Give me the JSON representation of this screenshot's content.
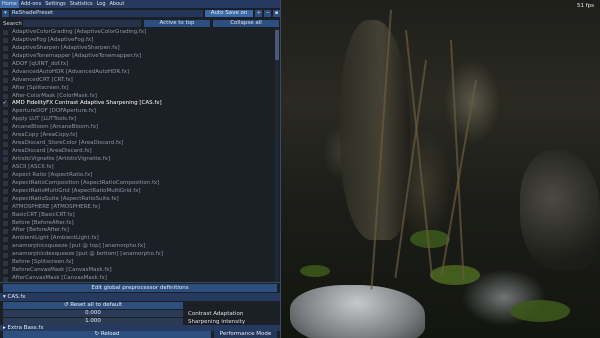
{
  "tabs": [
    "Home",
    "Add-ons",
    "Settings",
    "Statistics",
    "Log",
    "About"
  ],
  "preset": {
    "name": "ReShadePreset",
    "autosave_label": "Auto Save on"
  },
  "search": {
    "label": "Search",
    "placeholder": "",
    "active_to_top_label": "Active to top",
    "collapse_all_label": "Collapse all"
  },
  "effects": [
    {
      "label": "AdaptiveColorGrading [AdaptiveColorGrading.fx]",
      "enabled": false
    },
    {
      "label": "AdaptiveFog [AdaptiveFog.fx]",
      "enabled": false
    },
    {
      "label": "AdaptiveSharpen [AdaptiveSharpen.fx]",
      "enabled": false
    },
    {
      "label": "AdaptiveTonemapper [AdaptiveTonemapper.fx]",
      "enabled": false
    },
    {
      "label": "ADOF [qUINT_dof.fx]",
      "enabled": false
    },
    {
      "label": "AdvancedAutoHDR [AdvancedAutoHDR.fx]",
      "enabled": false
    },
    {
      "label": "AdvancedCRT [CRT.fx]",
      "enabled": false
    },
    {
      "label": "After [Splitscreen.fx]",
      "enabled": false
    },
    {
      "label": "After-ColorMask [ColorMask.fx]",
      "enabled": false
    },
    {
      "label": "AMD FidelityFX Contrast Adaptive Sharpening [CAS.fx]",
      "enabled": true
    },
    {
      "label": "ApertureDOF [DOFAperture.fx]",
      "enabled": false
    },
    {
      "label": "Apply LUT [LUTTools.fx]",
      "enabled": false
    },
    {
      "label": "ArcaneBloom [ArcaneBloom.fx]",
      "enabled": false
    },
    {
      "label": "AreaCopy [AreaCopy.fx]",
      "enabled": false
    },
    {
      "label": "AreaDiscard_StoreColor [AreaDiscard.fx]",
      "enabled": false
    },
    {
      "label": "AreaDiscard [AreaDiscard.fx]",
      "enabled": false
    },
    {
      "label": "ArtisticVignette [ArtisticVignette.fx]",
      "enabled": false
    },
    {
      "label": "ASCII [ASCII.fx]",
      "enabled": false
    },
    {
      "label": "Aspect Ratio [AspectRatio.fx]",
      "enabled": false
    },
    {
      "label": "AspectRatioComposition [AspectRatioComposition.fx]",
      "enabled": false
    },
    {
      "label": "AspectRatioMultiGrid [AspectRatioMultiGrid.fx]",
      "enabled": false
    },
    {
      "label": "AspectRatioSuite [AspectRatioSuite.fx]",
      "enabled": false
    },
    {
      "label": "ATMOSPHERE [ATMOSPHERE.fx]",
      "enabled": false
    },
    {
      "label": "BasicCRT [BasicCRT.fx]",
      "enabled": false
    },
    {
      "label": "Before [BeforeAfter.fx]",
      "enabled": false
    },
    {
      "label": "After [BeforeAfter.fx]",
      "enabled": false
    },
    {
      "label": "AmbientLight [AmbientLight.fx]",
      "enabled": false
    },
    {
      "label": "anamorphicsqueeze [put @ top] [anamorpho.fx]",
      "enabled": false
    },
    {
      "label": "anamorphicdesqueeze [put @ bottom] [anamorpho.fx]",
      "enabled": false
    },
    {
      "label": "Before [Splitscreen.fx]",
      "enabled": false
    },
    {
      "label": "BeforeCanvasMask [CanvasMask.fx]",
      "enabled": false
    },
    {
      "label": "AfterCanvasMask [CanvasMask.fx]",
      "enabled": false
    },
    {
      "label": "BeforeColorMask [ColorMask.fx]",
      "enabled": false
    }
  ],
  "edit_global_label": "Edit global preprocessor definitions",
  "cas_section": {
    "title": "CAS.fx",
    "reset_label": "Reset all to default",
    "params": [
      {
        "value": "0.000",
        "name": "Contrast Adaptation"
      },
      {
        "value": "1.000",
        "name": "Sharpening intensity"
      }
    ]
  },
  "extra_section_title": "Extra Bass.fx",
  "bottom": {
    "reload_label": "Reload",
    "perf_label": "Performance Mode"
  },
  "fps": "51 fps",
  "colors": {
    "accent": "#3c6aa8",
    "panel_bg": "#1b1f26",
    "header_bg": "#253a5e"
  }
}
